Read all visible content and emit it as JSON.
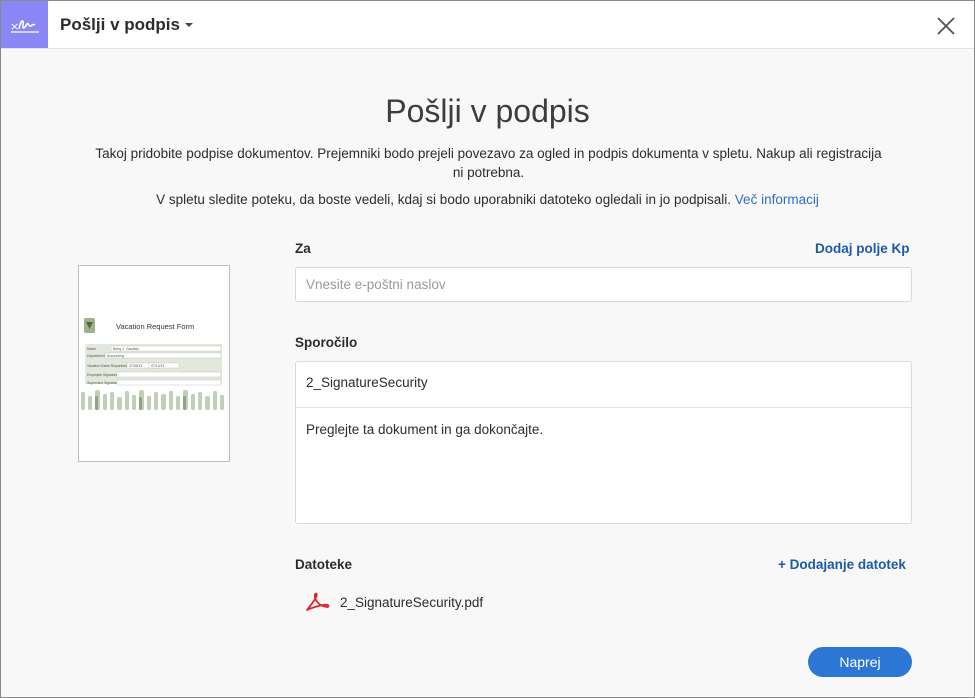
{
  "header": {
    "tool_title": "Pošlji v podpis",
    "icons": {
      "app": "sign-icon",
      "close": "close-icon",
      "caret": "caret-down-icon"
    }
  },
  "intro": {
    "heading": "Pošlji v podpis",
    "description": "Takoj pridobite podpise dokumentov. Prejemniki bodo prejeli povezavo za ogled in podpis dokumenta v spletu. Nakup ali registracija ni potrebna.",
    "tracking": "V spletu sledite poteku, da boste vedeli, kdaj si bodo uporabniki datoteko ogledali in jo podpisali.",
    "more_info_link": "Več informacij"
  },
  "thumbnail": {
    "title": "Vacation Request Form",
    "rows": [
      "Name",
      "Department",
      "Vacation Dates Requested",
      "Employee Signature",
      "Supervisor Signature"
    ],
    "values": [
      "Betsy J. Garofalo",
      "Accounting",
      "07/05/13",
      "07/12/13"
    ]
  },
  "to": {
    "label": "Za",
    "add_cc": "Dodaj polje Kp",
    "placeholder": "Vnesite e-poštni naslov"
  },
  "message": {
    "label": "Sporočilo",
    "subject": "2_SignatureSecurity",
    "body": "Preglejte ta dokument in ga dokončajte."
  },
  "files": {
    "label": "Datoteke",
    "add_files": "+ Dodajanje datotek",
    "items": [
      {
        "name": "2_SignatureSecurity.pdf",
        "icon": "pdf-icon"
      }
    ]
  },
  "actions": {
    "next": "Naprej"
  },
  "colors": {
    "accent": "#2c77d4",
    "link": "#1d5aa8",
    "app_icon_bg": "#8a86f5",
    "pdf_red": "#d7282f"
  }
}
